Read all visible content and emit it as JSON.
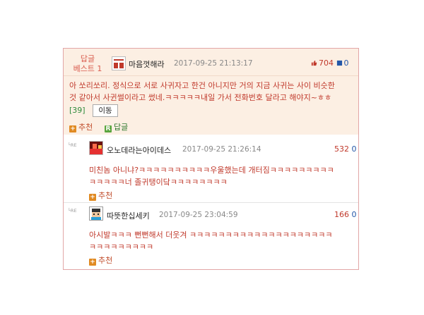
{
  "best": {
    "label_line1": "답글",
    "label_line2": "베스트 1",
    "nickname": "마음껏해라",
    "timestamp": "2017-09-25 21:13:17",
    "upvotes": "704",
    "downvotes": "0",
    "text_line1": "아 쏘리쏘리. 정식으로 서로 사귀자고 한건 아니지만 거의 지금 사귀는 사이 비슷한",
    "text_line2": "것 같아서 사귄썰이라고 썼네.ㅋㅋㅋㅋㅋ내일 가서 전화번호 달라고 해야지~ㅎㅎ",
    "reply_count": "[39]",
    "move_label": "이동",
    "recommend_label": "추천",
    "reply_label": "답글"
  },
  "replies": [
    {
      "re_tag": "RE",
      "nickname": "오노데라는아이데스",
      "timestamp": "2017-09-25 21:26:14",
      "upvotes": "532",
      "downvotes": "0",
      "text_line1": "미친놈 아니냐?ㅋㅋㅋㅋㅋㅋㅋㅋㅋㅋ우울했는데 개터짐ㅋㅋㅋㅋㅋㅋㅋㅋㅋ",
      "text_line2": "ㅋㅋㅋㅋㅋ너 졸귀탱이닼ㅋㅋㅋㅋㅋㅋㅋㅋ",
      "recommend_label": "추천"
    },
    {
      "re_tag": "RE",
      "nickname": "따뜻한십세키",
      "timestamp": "2017-09-25 23:04:59",
      "upvotes": "166",
      "downvotes": "0",
      "text_line1": "아시발ㅋㅋㅋ 뻔뻔해서 더웃겨 ㅋㅋㅋㅋㅋㅋㅋㅋㅋㅋㅋㅋㅋㅋㅋㅋㅋㅋㅋㅋ",
      "text_line2": "ㅋㅋㅋㅋㅋㅋㅋㅋㅋ",
      "recommend_label": "추천"
    }
  ],
  "colors": {
    "accent": "#c0392b",
    "best_bg": "#fcefe3",
    "border": "#e2a6a6",
    "down": "#2457a8"
  }
}
